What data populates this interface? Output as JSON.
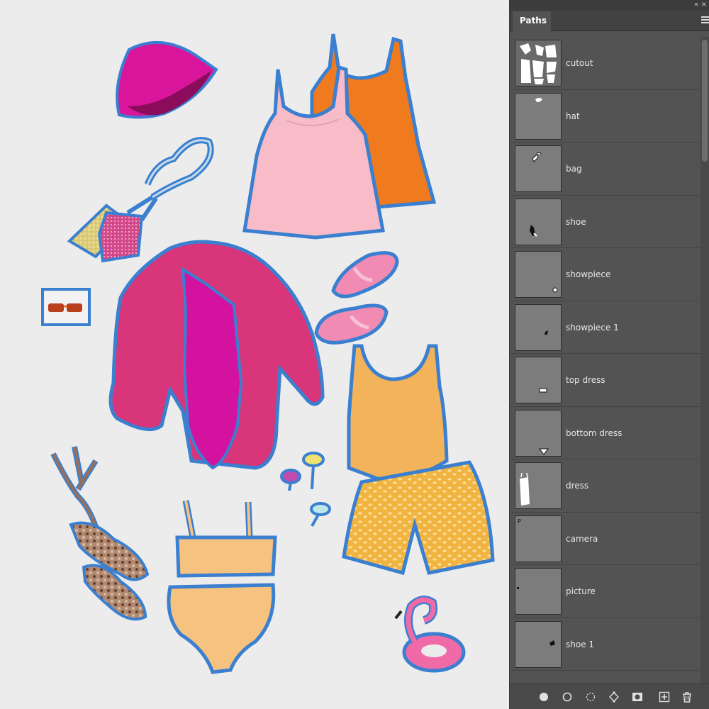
{
  "panel": {
    "tab_label": "Paths",
    "collapse_glyph": "‹‹",
    "close_glyph": "×",
    "paths": [
      {
        "label": "cutout",
        "thumb": "cutout"
      },
      {
        "label": "hat",
        "thumb": "hat"
      },
      {
        "label": "bag",
        "thumb": "bag"
      },
      {
        "label": "shoe",
        "thumb": "shoe"
      },
      {
        "label": "showpiece",
        "thumb": "showpiece"
      },
      {
        "label": "showpiece 1",
        "thumb": "showpiece1"
      },
      {
        "label": "top dress",
        "thumb": "topdress"
      },
      {
        "label": "bottom dress",
        "thumb": "bottomdress"
      },
      {
        "label": "dress",
        "thumb": "dress"
      },
      {
        "label": "camera",
        "thumb": "camera"
      },
      {
        "label": "picture",
        "thumb": "picture"
      },
      {
        "label": "shoe  1",
        "thumb": "shoe1"
      }
    ],
    "bottom_icons": [
      "fill-path-icon",
      "stroke-path-icon",
      "load-selection-icon",
      "make-work-path-icon",
      "add-mask-icon",
      "new-path-icon",
      "delete-path-icon"
    ]
  },
  "canvas": {
    "outline_color": "#3a7fd0",
    "background_color": "#ececec",
    "items": [
      "bucket-hat",
      "crossbody-bag",
      "sunglasses",
      "pink-tank-top",
      "orange-tank-top",
      "pink-sandals",
      "pink-shirt",
      "magenta-swimsuit",
      "yellow-tank-top",
      "yellow-shorts",
      "lace-up-sandals",
      "yellow-bikini",
      "drink-umbrellas",
      "flamingo-float"
    ]
  }
}
